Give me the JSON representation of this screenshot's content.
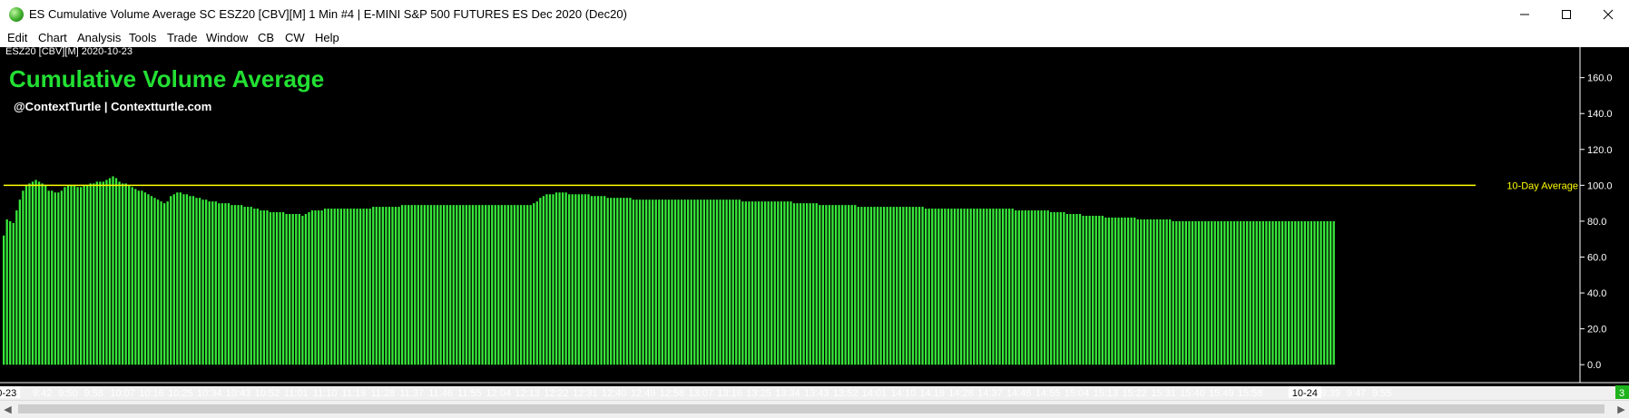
{
  "window": {
    "title": "ES Cumulative Volume Average  SC ESZ20 [CBV][M]  1 Min   #4 | E-MINI S&P 500 FUTURES ES Dec 2020 (Dec20)"
  },
  "menu": [
    "Edit",
    "Chart",
    "Analysis",
    "Tools",
    "Trade",
    "Window",
    "CB",
    "CW",
    "Help"
  ],
  "chart_header": {
    "symbol_label": "ESZ20 [CBV][M] 2020-10-23",
    "title": "Cumulative Volume Average",
    "subtitle": "@ContextTurtle | Contextturtle.com"
  },
  "colors": {
    "background": "#000000",
    "bar": "#37e83a",
    "average_line": "#ffff00",
    "title": "#22e033",
    "axis_text": "#ffffff",
    "badge": "#1db31d"
  },
  "status": {
    "badge": "3"
  },
  "chart_data": {
    "type": "bar",
    "title": "Cumulative Volume Average",
    "y_ticks": [
      "160.0",
      "140.0",
      "120.0",
      "100.0",
      "80.0",
      "60.0",
      "40.0",
      "20.0",
      "0.0"
    ],
    "ylim": [
      -10,
      177
    ],
    "x_tick_labels": [
      "10-23",
      "9:42",
      "9:50",
      "9:58",
      "10:07",
      "10:16",
      "10:25",
      "10:34",
      "10:43",
      "10:52",
      "11:01",
      "11:10",
      "11:19",
      "11:28",
      "11:37",
      "11:46",
      "11:55",
      "12:04",
      "12:13",
      "12:22",
      "12:31",
      "12:40",
      "12:49",
      "12:58",
      "13:07",
      "13:16",
      "13:25",
      "13:34",
      "13:43",
      "13:52",
      "14:01",
      "14:10",
      "14:19",
      "14:28",
      "14:37",
      "14:46",
      "14:55",
      "15:04",
      "15:13",
      "15:22",
      "15:31",
      "15:40",
      "15:49",
      "15:58",
      "10-24",
      "9:39",
      "9:47",
      "9:55"
    ],
    "x_tick_bar_index": [
      0,
      12,
      20,
      28,
      37,
      46,
      55,
      64,
      73,
      82,
      91,
      100,
      109,
      118,
      127,
      136,
      145,
      154,
      163,
      172,
      181,
      190,
      199,
      208,
      217,
      226,
      235,
      244,
      253,
      262,
      271,
      280,
      289,
      298,
      307,
      316,
      325,
      334,
      343,
      352,
      361,
      370,
      379,
      388,
      405,
      413,
      421,
      429
    ],
    "highlighted_ticks": [
      "10-23",
      "10-24"
    ],
    "bar_count": 400,
    "average_line": {
      "label": "10-Day Average",
      "value": 100
    },
    "series": [
      {
        "values": [
          72,
          81,
          80,
          79,
          86,
          92,
          97,
          100,
          101,
          102,
          103,
          102,
          101,
          100,
          97,
          97,
          96,
          96,
          97,
          99,
          100,
          100,
          100,
          99,
          99,
          100,
          100,
          101,
          101,
          102,
          102,
          102,
          103,
          104,
          105,
          104,
          102,
          101,
          101,
          100,
          99,
          98,
          97,
          97,
          96,
          95,
          94,
          93,
          92,
          91,
          90,
          91,
          94,
          95,
          96,
          96,
          95,
          95,
          94,
          94,
          93,
          93,
          92,
          92,
          91,
          91,
          91,
          90,
          90,
          90,
          90,
          89,
          89,
          89,
          89,
          88,
          88,
          88,
          87,
          87,
          86,
          86,
          86,
          85,
          85,
          85,
          85,
          85,
          84,
          84,
          84,
          84,
          84,
          83,
          84,
          85,
          86,
          86,
          86,
          86,
          87,
          87,
          87,
          87,
          87,
          87,
          87,
          87,
          87,
          87,
          87,
          87,
          87,
          87,
          87,
          88,
          88,
          88,
          88,
          88,
          88,
          88,
          88,
          88,
          89,
          89,
          89,
          89,
          89,
          89,
          89,
          89,
          89,
          89,
          89,
          89,
          89,
          89,
          89,
          89,
          89,
          89,
          89,
          89,
          89,
          89,
          89,
          89,
          89,
          89,
          89,
          89,
          89,
          89,
          89,
          89,
          89,
          89,
          89,
          89,
          89,
          89,
          89,
          89,
          89,
          90,
          91,
          93,
          94,
          95,
          95,
          95,
          96,
          96,
          96,
          96,
          95,
          95,
          95,
          95,
          95,
          95,
          95,
          94,
          94,
          94,
          94,
          94,
          93,
          93,
          93,
          93,
          93,
          93,
          93,
          93,
          92,
          92,
          92,
          92,
          92,
          92,
          92,
          92,
          92,
          92,
          92,
          92,
          92,
          92,
          92,
          92,
          92,
          92,
          92,
          92,
          92,
          92,
          92,
          92,
          92,
          92,
          92,
          92,
          92,
          92,
          92,
          92,
          92,
          92,
          91,
          91,
          91,
          91,
          91,
          91,
          91,
          91,
          91,
          91,
          91,
          91,
          91,
          91,
          91,
          91,
          90,
          90,
          90,
          90,
          90,
          90,
          90,
          90,
          89,
          89,
          89,
          89,
          89,
          89,
          89,
          89,
          89,
          89,
          89,
          89,
          88,
          88,
          88,
          88,
          88,
          88,
          88,
          88,
          88,
          88,
          88,
          88,
          88,
          88,
          88,
          88,
          88,
          88,
          88,
          88,
          88,
          87,
          87,
          87,
          87,
          87,
          87,
          87,
          87,
          87,
          87,
          87,
          87,
          87,
          87,
          87,
          87,
          87,
          87,
          87,
          87,
          87,
          87,
          87,
          87,
          87,
          87,
          87,
          87,
          86,
          86,
          86,
          86,
          86,
          86,
          86,
          86,
          86,
          86,
          86,
          85,
          85,
          85,
          85,
          85,
          84,
          84,
          84,
          84,
          84,
          83,
          83,
          83,
          83,
          83,
          83,
          83,
          82,
          82,
          82,
          82,
          82,
          82,
          82,
          82,
          82,
          82,
          81,
          81,
          81,
          81,
          81,
          81,
          81,
          81,
          81,
          81,
          81,
          80,
          80,
          80,
          80,
          80,
          80,
          80,
          80,
          80,
          80,
          80,
          80,
          80,
          80,
          80,
          80,
          80,
          80,
          80,
          80,
          80,
          80,
          80,
          80,
          80,
          80,
          80,
          80,
          80,
          80,
          80,
          80,
          80,
          80,
          80,
          80,
          80,
          80,
          80,
          80,
          80,
          80,
          80,
          80,
          80,
          80,
          80,
          80,
          80,
          80,
          80
        ]
      }
    ]
  }
}
